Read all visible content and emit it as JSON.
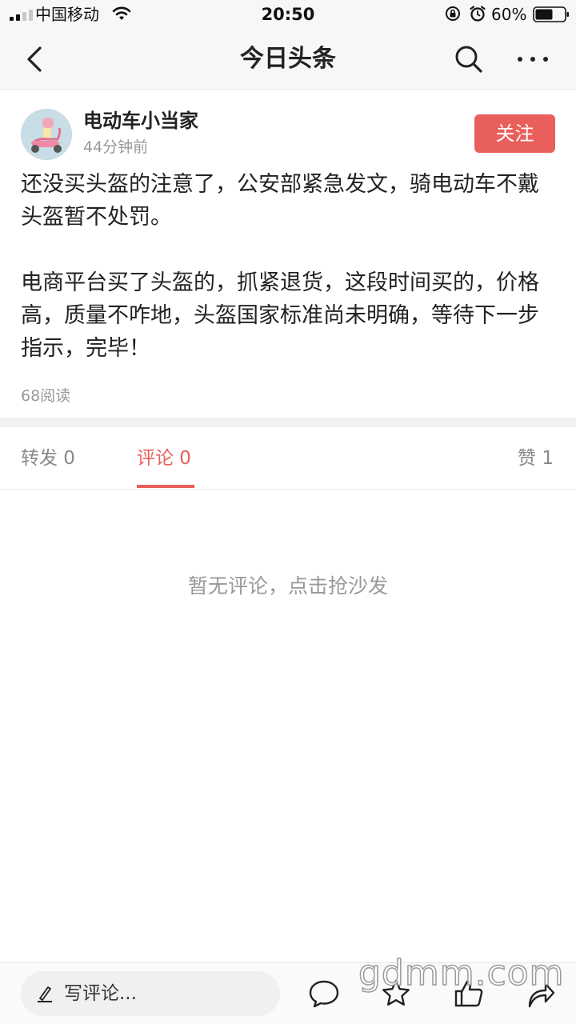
{
  "status_bar": {
    "carrier": "中国移动",
    "time": "20:50",
    "battery_percent": "60%",
    "battery_level": 0.6
  },
  "nav": {
    "title": "今日头条",
    "back_icon": "chevron-left-icon",
    "search_icon": "search-icon",
    "more_icon": "more-horizontal-icon"
  },
  "author": {
    "name": "电动车小当家",
    "time_ago": "44分钟前",
    "follow_label": "关注"
  },
  "post": {
    "paragraph_1": "还没买头盔的注意了，公安部紧急发文，骑电动车不戴头盔暂不处罚。",
    "paragraph_2": "电商平台买了头盔的，抓紧退货，这段时间买的，价格高，质量不咋地，头盔国家标准尚未明确，等待下一步指示，完毕！",
    "read_count": "68阅读"
  },
  "tabs": {
    "repost": "转发 0",
    "comment": "评论 0",
    "like": "赞 1",
    "active": "comment"
  },
  "comments": {
    "empty_text": "暂无评论，点击抢沙发"
  },
  "bottom_bar": {
    "input_placeholder": "写评论...",
    "icons": [
      "pen-icon",
      "comment-bubble-icon",
      "star-icon",
      "thumbs-up-icon",
      "share-icon"
    ]
  },
  "watermark": "gdmm.com",
  "colors": {
    "accent": "#e95f5b",
    "muted_text": "#999999",
    "bar_background": "#f7f7f7"
  }
}
